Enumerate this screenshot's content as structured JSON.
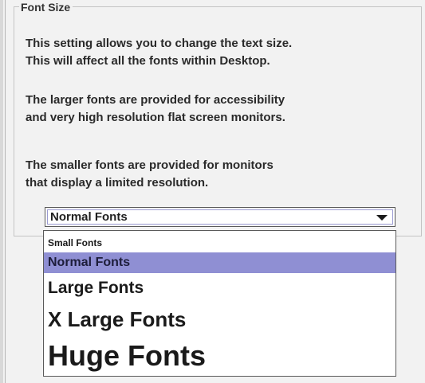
{
  "group": {
    "title": "Font Size",
    "paragraphs": [
      [
        "This setting allows you to change the text size.",
        "This will affect all the fonts within Desktop."
      ],
      [
        "The larger fonts are provided for accessibility",
        "and very high resolution flat screen monitors."
      ],
      [
        "The smaller fonts are provided for monitors",
        "that display a limited resolution."
      ]
    ]
  },
  "font_select": {
    "selected": "Normal Fonts",
    "icon": "chevron-down-icon",
    "options": [
      "Small Fonts",
      "Normal Fonts",
      "Large Fonts",
      "X Large Fonts",
      "Huge Fonts"
    ],
    "highlighted_index": 1
  },
  "colors": {
    "highlight": "#8f8fd3",
    "panel_background": "#f2f2f2",
    "group_border": "#c4c4c4"
  }
}
